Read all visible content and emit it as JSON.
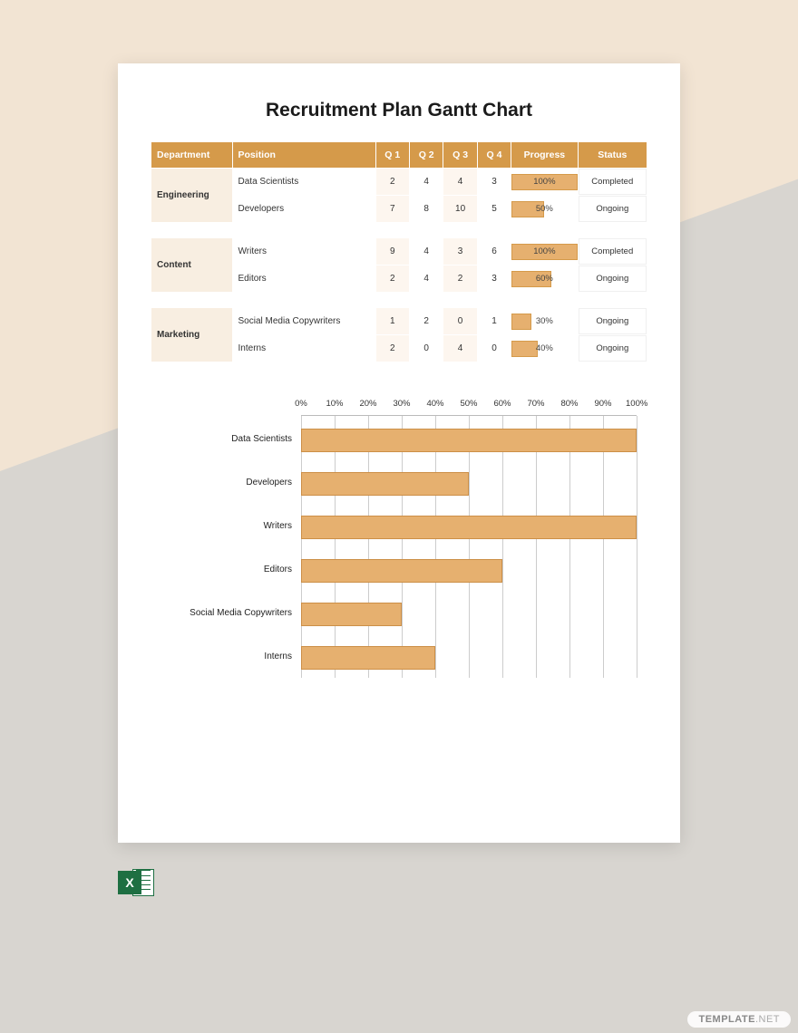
{
  "title": "Recruitment Plan Gantt Chart",
  "watermark": {
    "brand": "TEMPLATE",
    "tld": ".NET"
  },
  "excel_icon_letter": "X",
  "table": {
    "headers": {
      "department": "Department",
      "position": "Position",
      "q1": "Q 1",
      "q2": "Q 2",
      "q3": "Q 3",
      "q4": "Q 4",
      "progress": "Progress",
      "status": "Status"
    },
    "groups": [
      {
        "department": "Engineering",
        "rows": [
          {
            "position": "Data Scientists",
            "q": [
              2,
              4,
              4,
              3
            ],
            "progress": 100,
            "status": "Completed"
          },
          {
            "position": "Developers",
            "q": [
              7,
              8,
              10,
              5
            ],
            "progress": 50,
            "status": "Ongoing"
          }
        ]
      },
      {
        "department": "Content",
        "rows": [
          {
            "position": "Writers",
            "q": [
              9,
              4,
              3,
              6
            ],
            "progress": 100,
            "status": "Completed"
          },
          {
            "position": "Editors",
            "q": [
              2,
              4,
              2,
              3
            ],
            "progress": 60,
            "status": "Ongoing"
          }
        ]
      },
      {
        "department": "Marketing",
        "rows": [
          {
            "position": "Social Media Copywriters",
            "q": [
              1,
              2,
              0,
              1
            ],
            "progress": 30,
            "status": "Ongoing"
          },
          {
            "position": "Interns",
            "q": [
              2,
              0,
              4,
              0
            ],
            "progress": 40,
            "status": "Ongoing"
          }
        ]
      }
    ]
  },
  "chart_data": {
    "type": "bar",
    "orientation": "horizontal",
    "title": "",
    "xlabel": "",
    "ylabel": "",
    "xlim": [
      0,
      100
    ],
    "ticks": [
      "0%",
      "10%",
      "20%",
      "30%",
      "40%",
      "50%",
      "60%",
      "70%",
      "80%",
      "90%",
      "100%"
    ],
    "categories": [
      "Data Scientists",
      "Developers",
      "Writers",
      "Editors",
      "Social Media Copywriters",
      "Interns"
    ],
    "values": [
      100,
      50,
      100,
      60,
      30,
      40
    ]
  },
  "colors": {
    "header": "#d59a4a",
    "bar": "#e6b06f",
    "completed": "#c9e3b5",
    "ongoing": "#fce8a0"
  }
}
